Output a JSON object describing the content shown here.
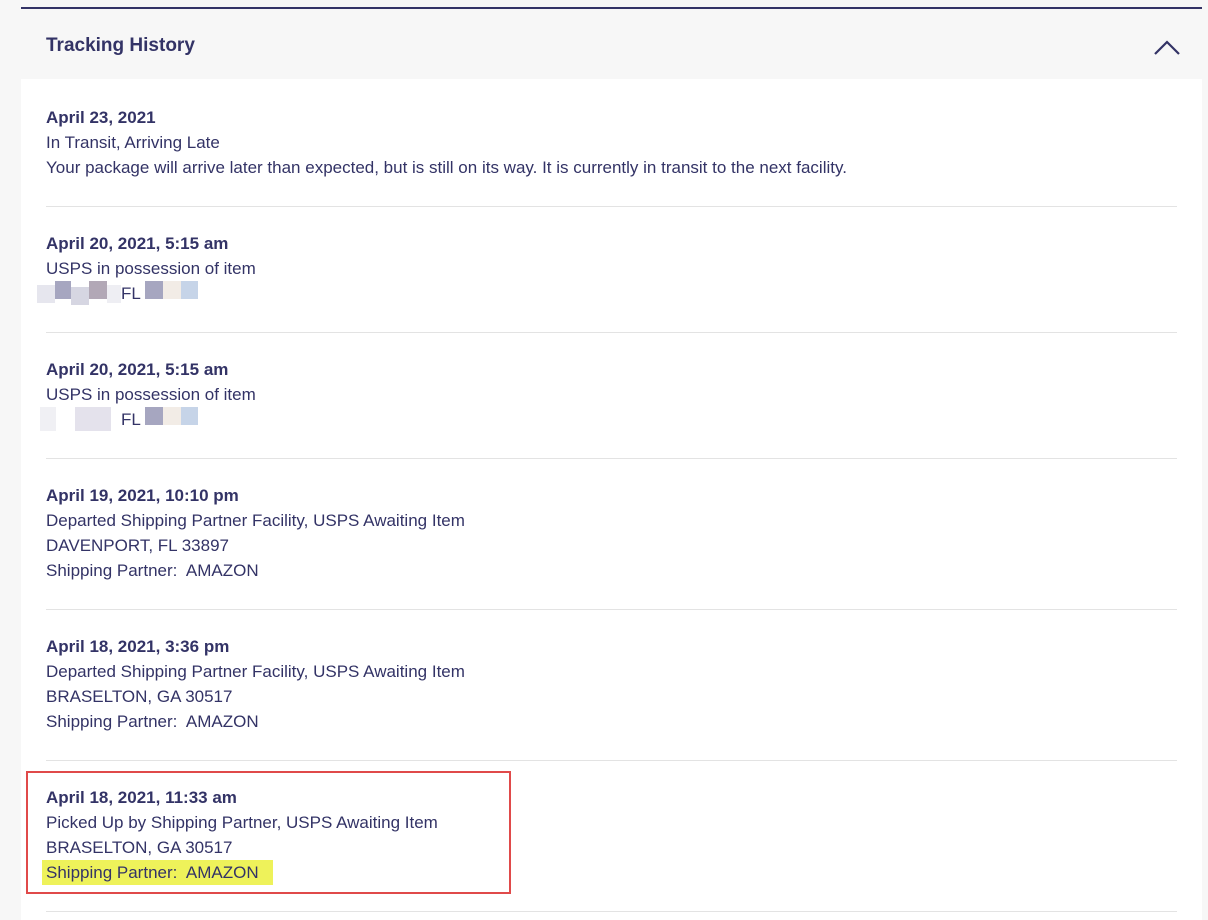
{
  "header": {
    "title": "Tracking History",
    "toggle_icon": "chevron-up-icon"
  },
  "events": [
    {
      "date": "April 23, 2021",
      "status": "In Transit, Arriving Late",
      "detail": "Your package will arrive later than expected, but is still on its way. It is currently in transit to the next facility."
    },
    {
      "date": "April 20, 2021, 5:15 am",
      "status": "USPS in possession of item",
      "location_state": "FL"
    },
    {
      "date": "April 20, 2021, 5:15 am",
      "status": "USPS in possession of item",
      "location_state": "FL"
    },
    {
      "date": "April 19, 2021, 10:10 pm",
      "status": "Departed Shipping Partner Facility, USPS Awaiting Item",
      "location": "DAVENPORT, FL 33897",
      "partner": "Shipping Partner:  AMAZON"
    },
    {
      "date": "April 18, 2021, 3:36 pm",
      "status": "Departed Shipping Partner Facility, USPS Awaiting Item",
      "location": "BRASELTON, GA 30517",
      "partner": "Shipping Partner:  AMAZON"
    },
    {
      "date": "April 18, 2021, 11:33 am",
      "status": "Picked Up by Shipping Partner, USPS Awaiting Item",
      "location": "BRASELTON, GA 30517",
      "partner": "Shipping Partner:  AMAZON"
    }
  ],
  "colors": {
    "text": "#333366",
    "highlight": "#eef25a",
    "annotation_border": "#e04a4a"
  }
}
